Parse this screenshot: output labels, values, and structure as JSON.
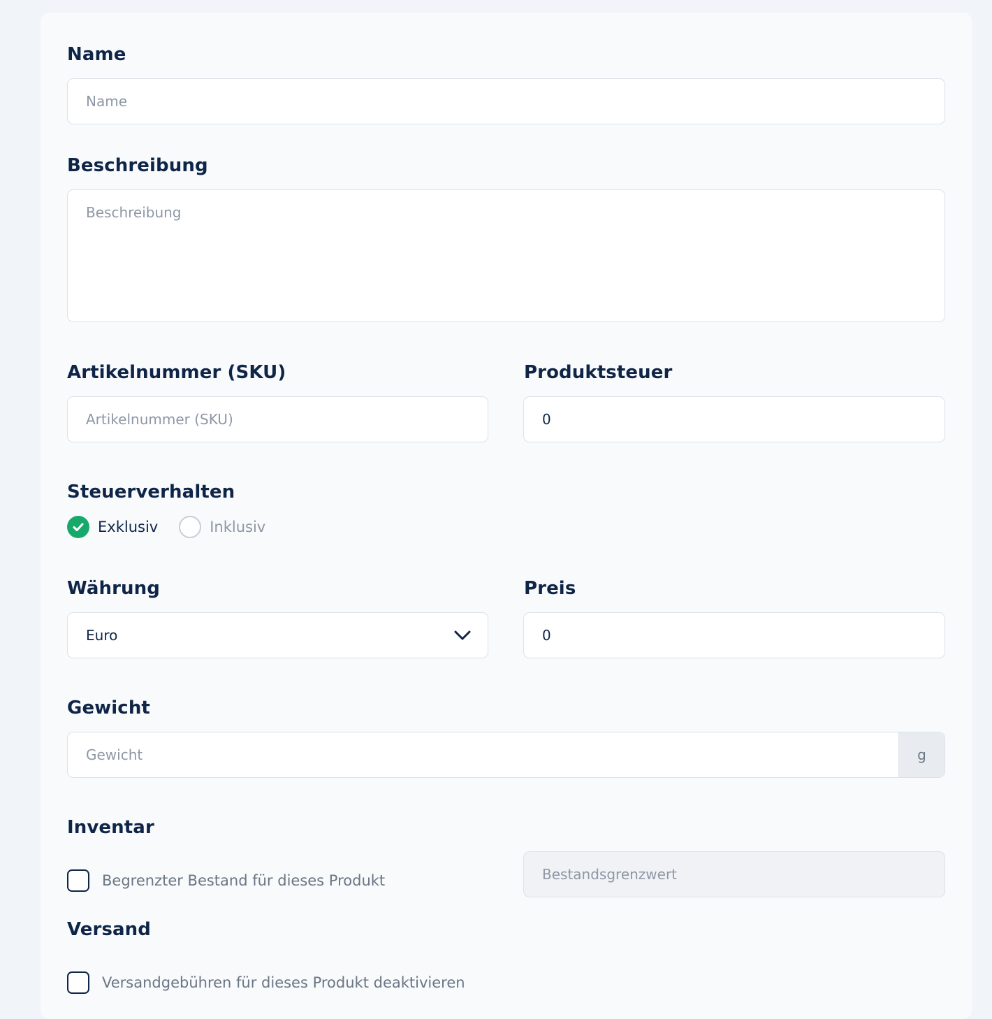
{
  "form": {
    "name": {
      "label": "Name",
      "placeholder": "Name",
      "value": ""
    },
    "description": {
      "label": "Beschreibung",
      "placeholder": "Beschreibung",
      "value": ""
    },
    "sku": {
      "label": "Artikelnummer (SKU)",
      "placeholder": "Artikelnummer (SKU)",
      "value": ""
    },
    "tax": {
      "label": "Produktsteuer",
      "value": "0"
    },
    "tax_behavior": {
      "label": "Steuerverhalten",
      "options": [
        {
          "label": "Exklusiv",
          "selected": true
        },
        {
          "label": "Inklusiv",
          "selected": false
        }
      ]
    },
    "currency": {
      "label": "Währung",
      "value": "Euro"
    },
    "price": {
      "label": "Preis",
      "value": "0"
    },
    "weight": {
      "label": "Gewicht",
      "placeholder": "Gewicht",
      "unit": "g",
      "value": ""
    },
    "inventory": {
      "label": "Inventar",
      "checkbox_label": "Begrenzter Bestand für dieses Produkt",
      "checked": false,
      "threshold_placeholder": "Bestandsgrenzwert"
    },
    "shipping": {
      "label": "Versand",
      "checkbox_label": "Versandgebühren für dieses Produkt deaktivieren",
      "checked": false
    }
  },
  "colors": {
    "accent_green": "#17a96b",
    "text_dark": "#0f2548",
    "placeholder": "#8e97a6",
    "border": "#dde2ea"
  },
  "icons": {
    "radio_selected": "check-circle-icon",
    "select": "chevron-down-icon"
  }
}
